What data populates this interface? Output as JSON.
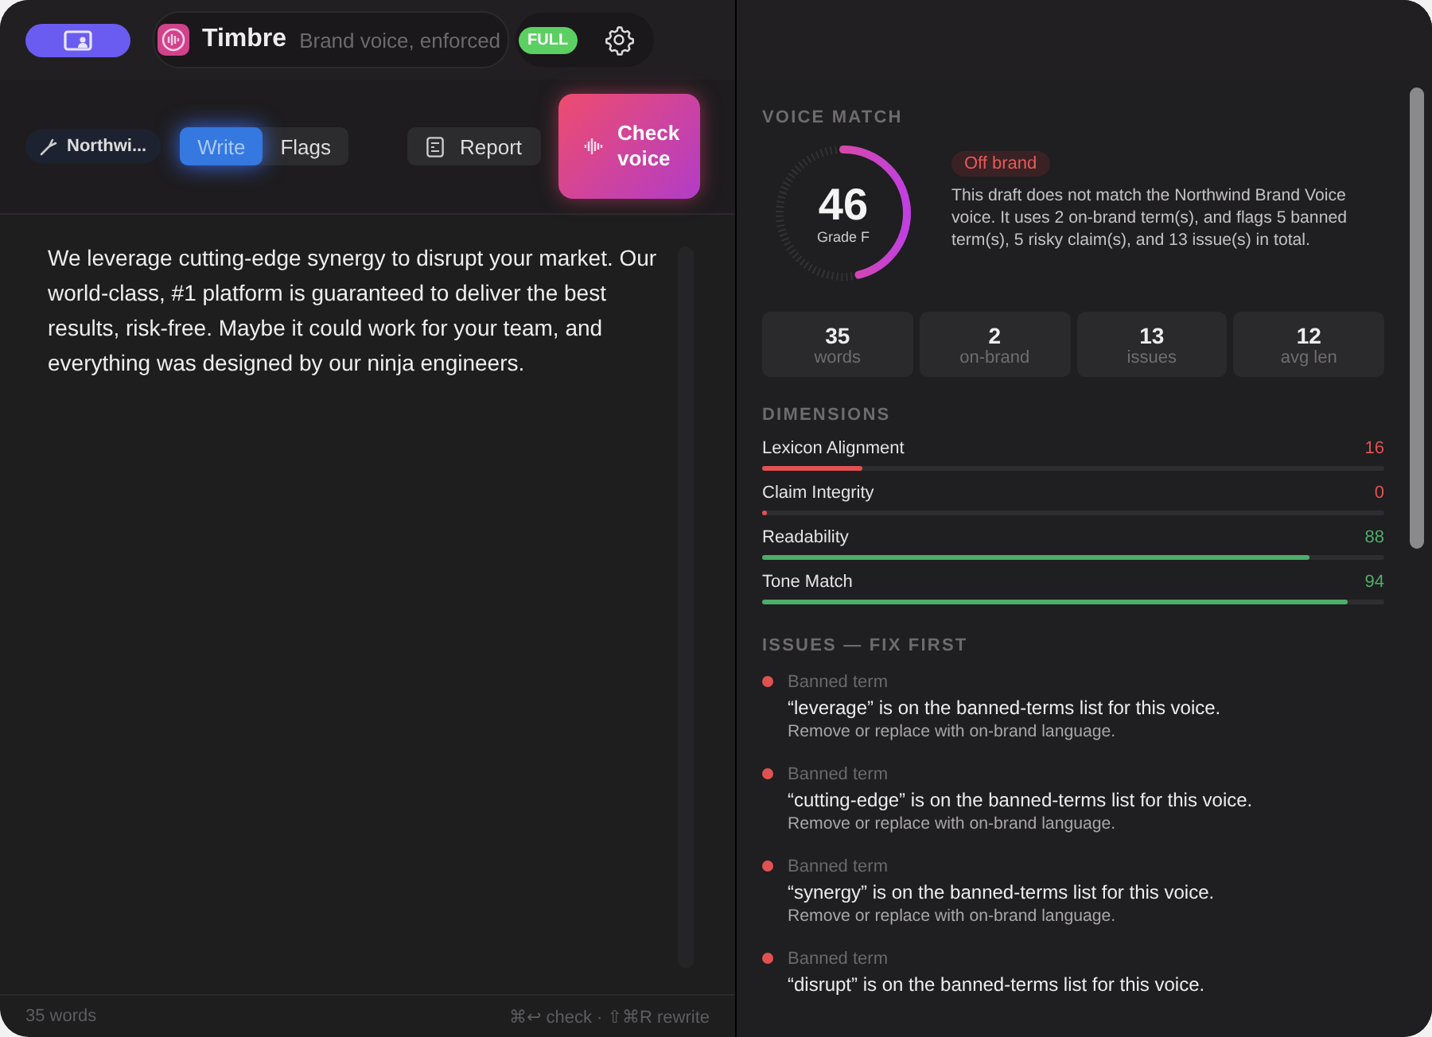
{
  "app": {
    "name": "Timbre",
    "tagline": "Brand voice, enforced",
    "plan_badge": "FULL"
  },
  "toolbar": {
    "voice_chip": "Northwi...",
    "tabs": [
      {
        "label": "Write",
        "selected": true
      },
      {
        "label": "Flags",
        "selected": false
      }
    ],
    "report_button": "Report",
    "check_button": "Check voice"
  },
  "editor": {
    "text": "We leverage cutting-edge synergy to disrupt your market. Our world-class, #1 platform is guaranteed to deliver the best results, risk-free. Maybe it could work for your team, and everything was designed by our ninja engineers."
  },
  "footer": {
    "word_count": "35 words",
    "shortcuts": "⌘↩ check · ⇧⌘R rewrite"
  },
  "voice_match": {
    "heading": "VOICE MATCH",
    "score": "46",
    "grade": "Grade F",
    "level": 0.46,
    "verdict": "Off brand",
    "summary": "This draft does not match the Northwind Brand Voice voice. It uses 2 on-brand term(s), and flags 5 banned term(s), 5 risky claim(s), and 13 issue(s) in total.",
    "stats": [
      {
        "value": "35",
        "label": "words"
      },
      {
        "value": "2",
        "label": "on-brand"
      },
      {
        "value": "13",
        "label": "issues"
      },
      {
        "value": "12",
        "label": "avg len"
      }
    ]
  },
  "dimensions": {
    "heading": "DIMENSIONS",
    "items": [
      {
        "name": "Lexicon Alignment",
        "score": "16",
        "level": 0.16,
        "color": "#e05252"
      },
      {
        "name": "Claim Integrity",
        "score": "0",
        "level": 0,
        "color": "#e05252"
      },
      {
        "name": "Readability",
        "score": "88",
        "level": 0.88,
        "color": "#4cae6a"
      },
      {
        "name": "Tone Match",
        "score": "94",
        "level": 0.94,
        "color": "#4cae6a"
      }
    ]
  },
  "issues": {
    "heading": "ISSUES — FIX FIRST",
    "items": [
      {
        "type": "Banned term",
        "message": "“leverage” is on the banned-terms list for this voice.",
        "fix": "Remove or replace with on-brand language.",
        "color": "#e05252"
      },
      {
        "type": "Banned term",
        "message": "“cutting-edge” is on the banned-terms list for this voice.",
        "fix": "Remove or replace with on-brand language.",
        "color": "#e05252"
      },
      {
        "type": "Banned term",
        "message": "“synergy” is on the banned-terms list for this voice.",
        "fix": "Remove or replace with on-brand language.",
        "color": "#e05252"
      },
      {
        "type": "Banned term",
        "message": "“disrupt” is on the banned-terms list for this voice.",
        "color": "#e05252"
      }
    ]
  }
}
